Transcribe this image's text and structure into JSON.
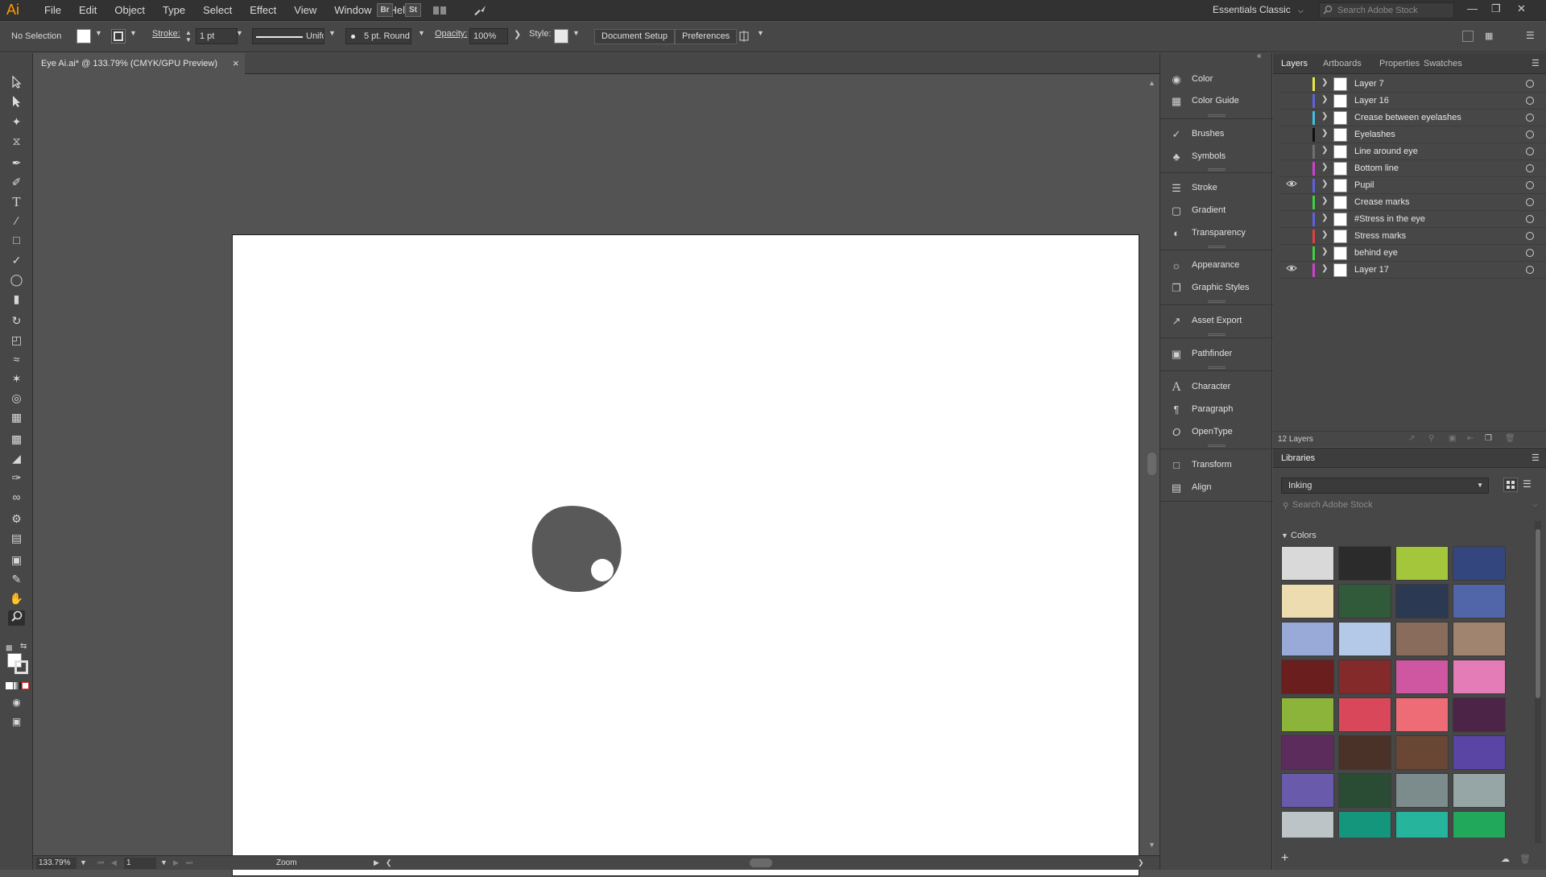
{
  "app": {
    "logo": "Ai"
  },
  "menu": [
    "File",
    "Edit",
    "Object",
    "Type",
    "Select",
    "Effect",
    "View",
    "Window",
    "Help"
  ],
  "bridge_labels": {
    "br": "Br",
    "st": "St"
  },
  "workspace": "Essentials Classic",
  "search_stock_placeholder": "Search Adobe Stock",
  "control_bar": {
    "selection": "No Selection",
    "stroke_label": "Stroke:",
    "stroke_weight": "1 pt",
    "stroke_profile": "Uniform",
    "brush": "5 pt. Round",
    "opacity_label": "Opacity:",
    "opacity_value": "100%",
    "style_label": "Style:",
    "document_setup": "Document Setup",
    "preferences": "Preferences"
  },
  "document_tab": {
    "title": "Eye Ai.ai* @ 133.79% (CMYK/GPU Preview)"
  },
  "status": {
    "zoom": "133.79%",
    "artboard": "1",
    "tool": "Zoom"
  },
  "icon_panels": [
    {
      "icon": "color-icon",
      "label": "Color"
    },
    {
      "icon": "color-guide-icon",
      "label": "Color Guide"
    },
    {
      "icon": "brushes-icon",
      "label": "Brushes"
    },
    {
      "icon": "symbols-icon",
      "label": "Symbols"
    },
    {
      "icon": "stroke-icon",
      "label": "Stroke"
    },
    {
      "icon": "gradient-icon",
      "label": "Gradient"
    },
    {
      "icon": "transparency-icon",
      "label": "Transparency"
    },
    {
      "icon": "appearance-icon",
      "label": "Appearance"
    },
    {
      "icon": "graphic-styles-icon",
      "label": "Graphic Styles"
    },
    {
      "icon": "asset-export-icon",
      "label": "Asset Export"
    },
    {
      "icon": "pathfinder-icon",
      "label": "Pathfinder"
    },
    {
      "icon": "character-icon",
      "label": "Character"
    },
    {
      "icon": "paragraph-icon",
      "label": "Paragraph"
    },
    {
      "icon": "opentype-icon",
      "label": "OpenType"
    },
    {
      "icon": "transform-icon",
      "label": "Transform"
    },
    {
      "icon": "align-icon",
      "label": "Align"
    }
  ],
  "layers_panel": {
    "tabs": [
      "Layers",
      "Artboards",
      "Properties",
      "Swatches"
    ],
    "layers": [
      {
        "name": "Layer 7",
        "color": "#e8e840",
        "visible": false
      },
      {
        "name": "Layer 16",
        "color": "#6060e0",
        "visible": false
      },
      {
        "name": "Crease between eyelashes",
        "color": "#40c0e0",
        "visible": false
      },
      {
        "name": "Eyelashes",
        "color": "#101010",
        "visible": false
      },
      {
        "name": "Line around eye",
        "color": "#707070",
        "visible": false
      },
      {
        "name": "Bottom line",
        "color": "#d040d0",
        "visible": false
      },
      {
        "name": "Pupil",
        "color": "#6060e0",
        "visible": true
      },
      {
        "name": "Crease marks",
        "color": "#40d040",
        "visible": false
      },
      {
        "name": "#Stress in the eye",
        "color": "#6060e0",
        "visible": false
      },
      {
        "name": "Stress marks",
        "color": "#e04040",
        "visible": false
      },
      {
        "name": "behind eye",
        "color": "#40d040",
        "visible": false
      },
      {
        "name": "Layer 17",
        "color": "#d040d0",
        "visible": true
      }
    ],
    "count": "12 Layers"
  },
  "libraries_panel": {
    "title": "Libraries",
    "library": "Inking",
    "search_placeholder": "Search Adobe Stock",
    "section": "Colors",
    "colors": [
      "#d9d9d9",
      "#2b2b2b",
      "#a4c63a",
      "#34467e",
      "#ecdcb0",
      "#305a3a",
      "#2b3a52",
      "#5066a8",
      "#9aaad8",
      "#b4c8e8",
      "#8a6c5c",
      "#a08470",
      "#6a1e1e",
      "#842a2a",
      "#cf56a0",
      "#e47cb8",
      "#8cb43a",
      "#d8485a",
      "#ee6c76",
      "#4c2448",
      "#5c2c5c",
      "#4a3228",
      "#6a4634",
      "#5a44a4",
      "#6a5aac",
      "#2a4c34",
      "#7c8c8c",
      "#96a6a6",
      "#bcc4c8",
      "#14967c",
      "#26b49c",
      "#22a85a"
    ]
  }
}
